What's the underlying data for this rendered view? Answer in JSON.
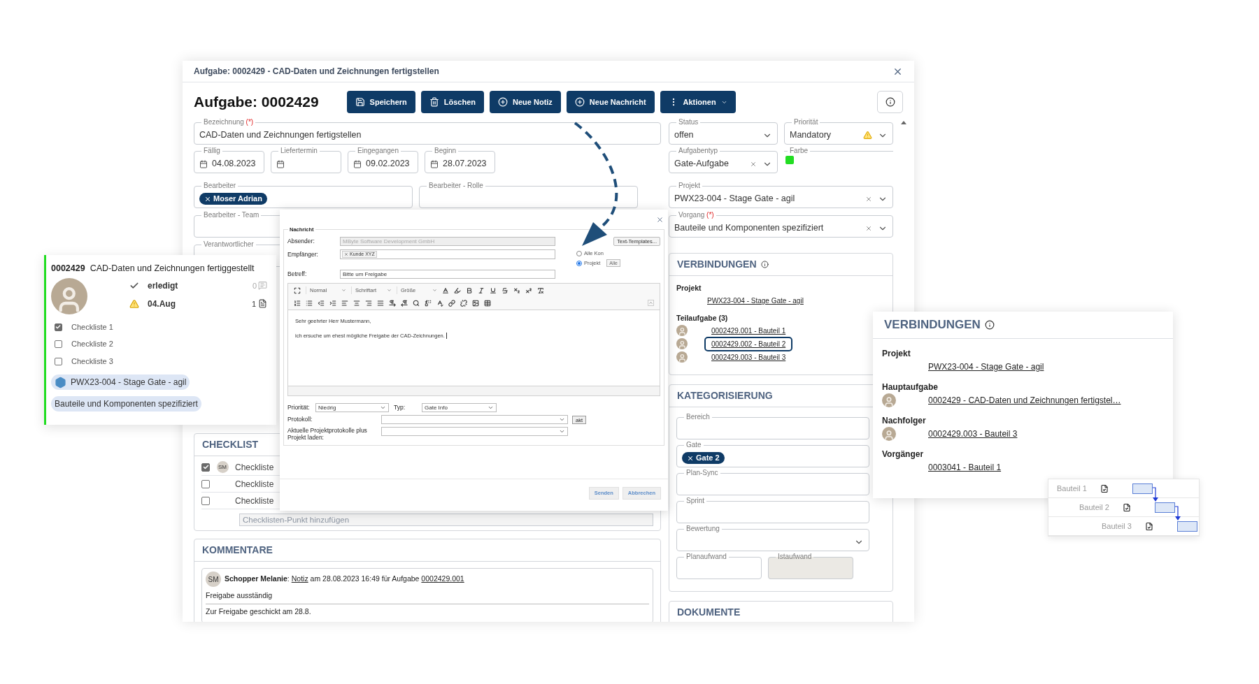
{
  "window": {
    "title": "Aufgabe: 0002429 - CAD-Daten und Zeichnungen fertigstellen"
  },
  "heading": "Aufgabe: 0002429",
  "toolbar": [
    {
      "label": "Speichern",
      "kind": "save",
      "has_menu": false
    },
    {
      "label": "Löschen",
      "kind": "delete",
      "has_menu": false
    },
    {
      "label": "Neue Notiz",
      "kind": "add",
      "has_menu": false
    },
    {
      "label": "Neue Nachricht",
      "kind": "add",
      "has_menu": false
    },
    {
      "label": "Aktionen",
      "kind": "menu",
      "has_menu": true
    }
  ],
  "left_rows": [
    {
      "fields": [
        {
          "label": "Bezeichnung",
          "required_mark": "(*)",
          "kind": "text",
          "value": "CAD-Daten und Zeichnungen fertigstellen"
        }
      ]
    },
    {
      "fields": [
        {
          "label": "Fällig",
          "kind": "date",
          "value": "04.08.2023"
        },
        {
          "label": "Liefertermin",
          "kind": "date"
        },
        {
          "label": "Eingegangen",
          "kind": "date",
          "value": "09.02.2023"
        },
        {
          "label": "Beginn",
          "kind": "date",
          "value": "28.07.2023"
        }
      ]
    },
    {
      "fields": [
        {
          "label": "Bearbeiter",
          "kind": "chips",
          "chips": [
            "Moser Adrian"
          ]
        },
        {
          "label": "Bearbeiter - Rolle",
          "kind": "text"
        }
      ]
    },
    {
      "fields": [
        {
          "label": "Bearbeiter - Team",
          "kind": "text"
        }
      ]
    },
    {
      "fields": [
        {
          "label": "Verantwortlicher",
          "kind": "text"
        }
      ]
    }
  ],
  "right_rows": [
    {
      "fields": [
        {
          "label": "Status",
          "kind": "select",
          "value": "offen"
        },
        {
          "label": "Priorität",
          "kind": "select",
          "value": "Mandatory",
          "warning": true
        }
      ]
    },
    {
      "fields": [
        {
          "label": "Aufgabentyp",
          "kind": "select",
          "value": "Gate-Aufgabe",
          "clearable": true
        },
        {
          "label": "Farbe",
          "kind": "color",
          "color": "#22dd22"
        }
      ]
    },
    {
      "fields": [
        {
          "label": "Projekt",
          "kind": "select",
          "value": "PWX23-004 - Stage Gate - agil",
          "clearable": true
        }
      ]
    },
    {
      "fields": [
        {
          "label": "Vorgang",
          "required_mark": "(*)",
          "kind": "select",
          "value": "Bauteile und Komponenten spezifiziert",
          "clearable": true
        }
      ]
    }
  ],
  "checklist": {
    "title": "CHECKLIST",
    "items": [
      {
        "text": "Checkliste",
        "checked": true,
        "avatar": "SM"
      },
      {
        "text": "Checkliste",
        "checked": false
      },
      {
        "text": "Checkliste",
        "checked": false
      }
    ],
    "placeholder": "Checklisten-Punkt hinzufügen"
  },
  "comments": {
    "title": "KOMMENTARE",
    "items": [
      {
        "avatar": "SM",
        "author": "Schopper Melanie",
        "sep": ":",
        "link": "Notiz",
        "middle": "am 28.08.2023 16:49 für Aufgabe",
        "target": "0002429.001",
        "lines": [
          "Freigabe ausständig",
          "Zur Freigabe geschickt am 28.8."
        ]
      }
    ]
  },
  "connections": {
    "title": "VERBINDUNGEN",
    "project_label": "Projekt",
    "project_link": "PWX23-004 - Stage Gate - agil",
    "sub_label": "Teilaufgabe (3)",
    "subtasks": [
      {
        "text": "0002429.001 - Bauteil 1",
        "selected": false
      },
      {
        "text": "0002429.002 - Bauteil 2",
        "selected": true
      },
      {
        "text": "0002429.003 - Bauteil 3",
        "selected": false
      }
    ]
  },
  "categories": {
    "title": "KATEGORISIERUNG",
    "rows": [
      {
        "fields": [
          {
            "label": "Bereich",
            "kind": "text"
          }
        ]
      },
      {
        "fields": [
          {
            "label": "Gate",
            "kind": "chips",
            "chips": [
              "Gate 2"
            ]
          }
        ]
      },
      {
        "fields": [
          {
            "label": "Plan-Sync",
            "kind": "text"
          }
        ]
      },
      {
        "fields": [
          {
            "label": "Sprint",
            "kind": "text"
          }
        ]
      },
      {
        "fields": [
          {
            "label": "Bewertung",
            "kind": "select"
          }
        ]
      },
      {
        "fields": [
          {
            "label": "Planaufwand",
            "kind": "text",
            "disabled": false
          },
          {
            "label": "Istaufwand",
            "kind": "text",
            "disabled": true
          }
        ]
      }
    ]
  },
  "documents": {
    "title": "DOKUMENTE"
  },
  "card": {
    "id": "0002429",
    "title": "CAD-Daten und Zeichnungen fertiggestellt",
    "status": "erledigt",
    "comments": "0",
    "due": "04.Aug",
    "due_warning": true,
    "docs": "1",
    "checklist": [
      {
        "text": "Checkliste 1",
        "checked": true
      },
      {
        "text": "Checkliste 2",
        "checked": false
      },
      {
        "text": "Checkliste 3",
        "checked": false
      }
    ],
    "tags": [
      {
        "text": "PWX23-004 - Stage Gate - agil",
        "kind": "project"
      },
      {
        "text": "Bauteile und Komponenten spezifiziert",
        "kind": "step"
      }
    ]
  },
  "dialog": {
    "legend": "Nachricht",
    "sender_label": "Absender:",
    "sender": "MByte Software Development GmbH",
    "templates": "Text-Templates...",
    "recipient_label": "Empfänger:",
    "recipients": [
      "Kunde XYZ"
    ],
    "radios": [
      {
        "label": "Alle Kon",
        "selected": false
      },
      {
        "label": "Projekt",
        "selected": true
      }
    ],
    "all_button": "Alle",
    "subject_label": "Betreff:",
    "subject": "Bitte um Freigabe",
    "format": "Normal",
    "font": "Schriftart",
    "size": "Größe",
    "body": [
      "Sehr geehrter Herr Mustermann,",
      "ich ersuche um ehest mögliche Freigabe der CAD-Zeichnungen."
    ],
    "priority_label": "Priorität:",
    "priority": "Niedrig",
    "type_label": "Typ:",
    "type": "Gate Info",
    "protocol_label": "Protokoll:",
    "akt": "akt",
    "load_label": "Aktuelle Projektprotokolle plus Projekt laden:",
    "buttons": [
      "Senden",
      "Abbrechen"
    ]
  },
  "popup": {
    "title": "VERBINDUNGEN",
    "sections": [
      {
        "label": "Projekt",
        "link": "PWX23-004 - Stage Gate - agil"
      },
      {
        "label": "Hauptaufgabe",
        "link": "0002429 - CAD-Daten und Zeichnungen fertigstel…",
        "avatar": true
      },
      {
        "label": "Nachfolger",
        "link": "0002429.003 - Bauteil 3",
        "avatar": true
      },
      {
        "label": "Vorgänger",
        "link": "0003041 - Bauteil 1"
      }
    ]
  },
  "gantt": {
    "rows": [
      {
        "label": "Bauteil 1"
      },
      {
        "label": "Bauteil 2"
      },
      {
        "label": "Bauteil 3"
      }
    ]
  }
}
